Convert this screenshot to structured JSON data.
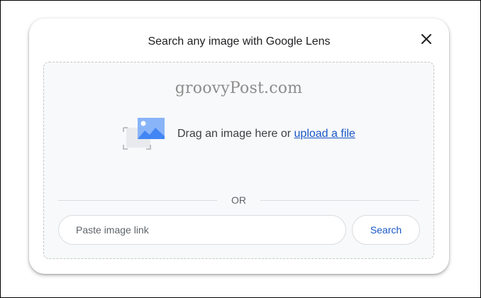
{
  "dialog": {
    "title": "Search any image with Google Lens",
    "close_icon": "close-icon"
  },
  "drop_zone": {
    "watermark": "groovyPost.com",
    "image_icon": "image-upload-icon",
    "drag_text": "Drag an image here or ",
    "upload_link": "upload a file"
  },
  "divider": {
    "or_label": "OR"
  },
  "link_search": {
    "placeholder": "Paste image link",
    "value": "",
    "search_label": "Search"
  },
  "colors": {
    "accent": "#1a57c6",
    "image_icon_blue": "#4285f4",
    "drop_zone_bg": "#f8f9fa"
  }
}
